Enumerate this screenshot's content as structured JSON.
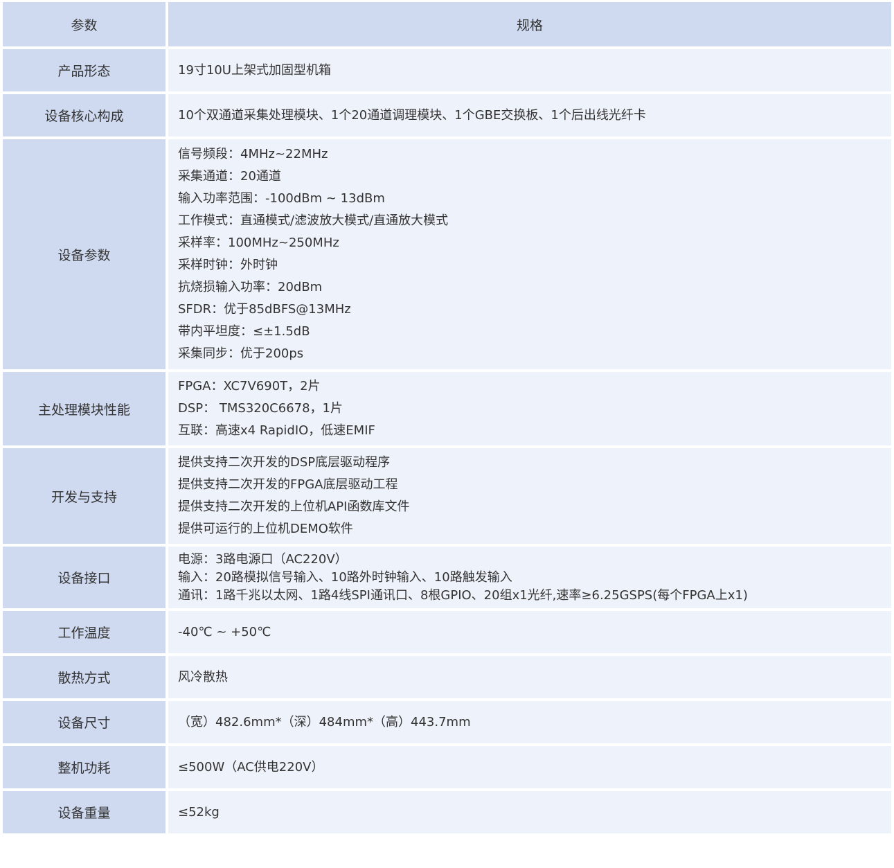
{
  "header": {
    "param": "参数",
    "spec": "规格"
  },
  "rows": [
    {
      "param": "产品形态",
      "lines": [
        "19寸10U上架式加固型机箱"
      ]
    },
    {
      "param": "设备核心构成",
      "lines": [
        "10个双通道采集处理模块、1个20通道调理模块、1个GBE交换板、1个后出线光纤卡"
      ]
    },
    {
      "param": "设备参数",
      "lines": [
        "信号频段：4MHz~22MHz",
        "采集通道：20通道",
        "输入功率范围：-100dBm ~ 13dBm",
        "工作模式：直通模式/滤波放大模式/直通放大模式",
        "采样率：100MHz~250MHz",
        "采样时钟：外时钟",
        "抗烧损输入功率：20dBm",
        "SFDR：优于85dBFS@13MHz",
        "带内平坦度：≤±1.5dB",
        "采集同步：优于200ps"
      ]
    },
    {
      "param": "主处理模块性能",
      "lines": [
        "FPGA：XC7V690T，2片",
        "DSP： TMS320C6678，1片",
        "互联：高速x4 RapidIO，低速EMIF"
      ]
    },
    {
      "param": "开发与支持",
      "lines": [
        "提供支持二次开发的DSP底层驱动程序",
        "提供支持二次开发的FPGA底层驱动工程",
        "提供支持二次开发的上位机API函数库文件",
        "提供可运行的上位机DEMO软件"
      ]
    },
    {
      "param": "设备接口",
      "lines": [
        "电源：3路电源口（AC220V）",
        "输入：20路模拟信号输入、10路外时钟输入、10路触发输入",
        "通讯：1路千兆以太网、1路4线SPI通讯口、8根GPIO、20组x1光纤,速率≥6.25GSPS(每个FPGA上x1)"
      ]
    },
    {
      "param": "工作温度",
      "lines": [
        "-40℃ ~ +50℃"
      ]
    },
    {
      "param": "散热方式",
      "lines": [
        "风冷散热"
      ]
    },
    {
      "param": "设备尺寸",
      "lines": [
        "（宽）482.6mm*（深）484mm*（高）443.7mm"
      ]
    },
    {
      "param": "整机功耗",
      "lines": [
        "≤500W（AC供电220V）"
      ]
    },
    {
      "param": "设备重量",
      "lines": [
        "≤52kg"
      ]
    }
  ]
}
